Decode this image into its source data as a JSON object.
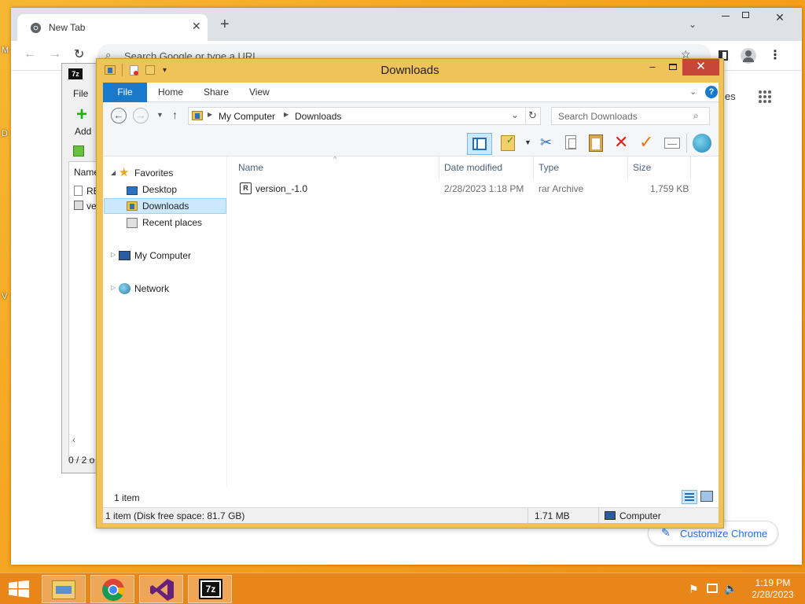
{
  "desktop": {
    "edge_labels": [
      "M",
      "D",
      "V"
    ]
  },
  "chrome": {
    "tab_title": "New Tab",
    "omnibox_placeholder": "Search Google or type a URL",
    "right_text": "es",
    "customize_label": "Customize Chrome"
  },
  "sevenzip": {
    "menu_file": "File",
    "add_label": "Add",
    "col_name": "Name",
    "row1": "RE",
    "row2": "ve",
    "status": "0 / 2 o"
  },
  "explorer": {
    "title": "Downloads",
    "ribbon_tabs": [
      "File",
      "Home",
      "Share",
      "View"
    ],
    "breadcrumb": [
      "My Computer",
      "Downloads"
    ],
    "search_placeholder": "Search Downloads",
    "nav": {
      "favorites": "Favorites",
      "desktop": "Desktop",
      "downloads": "Downloads",
      "recent": "Recent places",
      "computer": "My Computer",
      "network": "Network"
    },
    "columns": [
      "Name",
      "Date modified",
      "Type",
      "Size"
    ],
    "files": [
      {
        "name": "version_-1.0",
        "date": "2/28/2023 1:18 PM",
        "type": "rar Archive",
        "size": "1,759 KB"
      }
    ],
    "item_count": "1 item",
    "status_left": "1 item (Disk free space: 81.7 GB)",
    "status_size": "1.71 MB",
    "status_location": "Computer"
  },
  "taskbar": {
    "time": "1:19 PM",
    "date": "2/28/2023",
    "apps": [
      "File Explorer",
      "Google Chrome",
      "Visual Studio",
      "7-Zip"
    ]
  },
  "colors": {
    "accent": "#1979ca",
    "frame": "#f0c25a",
    "close": "#c7463a",
    "desktop": "#f5a31f"
  }
}
